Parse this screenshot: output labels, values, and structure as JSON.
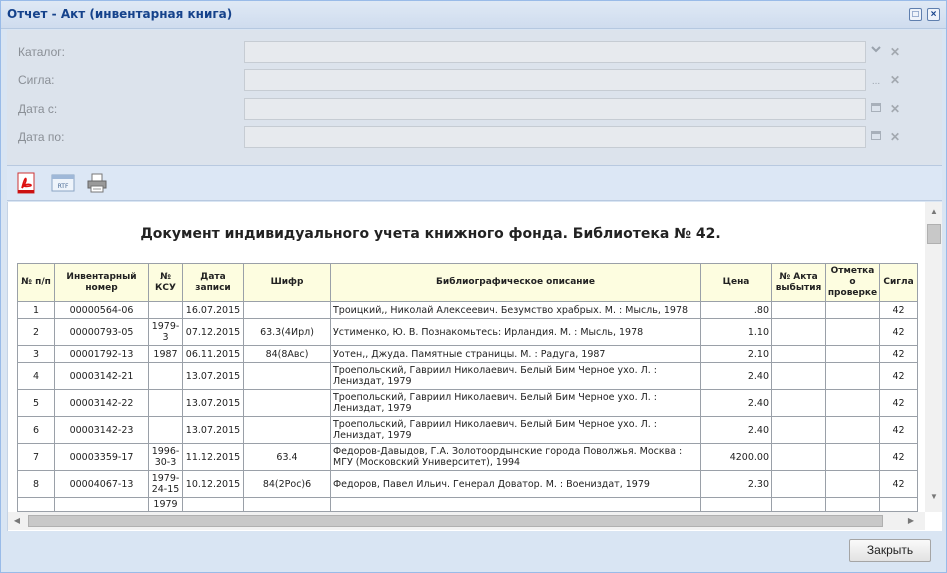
{
  "window": {
    "title": "Отчет - Акт (инвентарная книга)"
  },
  "form": {
    "fields": [
      {
        "label": "Каталог:",
        "value": "",
        "trigger": "chevron-down-icon"
      },
      {
        "label": "Сигла:",
        "value": "",
        "trigger": "ellipsis-icon"
      },
      {
        "label": "Дата с:",
        "value": "",
        "trigger": "calendar-icon"
      },
      {
        "label": "Дата по:",
        "value": "",
        "trigger": "calendar-icon"
      }
    ],
    "ellipsis": "...",
    "clear": "✕"
  },
  "toolbar": {
    "icons": [
      "pdf-icon",
      "rtf-icon",
      "print-icon"
    ],
    "rtf_text": "RTF"
  },
  "report": {
    "title": "Документ индивидуального учета книжного фонда. Библиотека № 42.",
    "columns": [
      "№ п/п",
      "Инвентарный номер",
      "№ КСУ",
      "Дата записи",
      "Шифр",
      "Библиографическое описание",
      "Цена",
      "№ Акта выбытия",
      "Отметка о проверке",
      "Сигла"
    ],
    "rows": [
      [
        "1",
        "00000564-06",
        "",
        "16.07.2015",
        "",
        "Троицкий,, Николай Алексеевич. Безумство храбрых. М. : Мысль, 1978",
        ".80",
        "",
        "",
        "42"
      ],
      [
        "2",
        "00000793-05",
        "1979-3",
        "07.12.2015",
        "63.3(4Ирл)",
        "Устименко, Ю. В. Познакомьтесь: Ирландия. М. : Мысль, 1978",
        "1.10",
        "",
        "",
        "42"
      ],
      [
        "3",
        "00001792-13",
        "1987",
        "06.11.2015",
        "84(8Авс)",
        "Уотен,, Джуда. Памятные страницы. М. : Радуга, 1987",
        "2.10",
        "",
        "",
        "42"
      ],
      [
        "4",
        "00003142-21",
        "",
        "13.07.2015",
        "",
        "Троепольский, Гавриил Николаевич. Белый Бим Черное ухо. Л. : Лениздат, 1979",
        "2.40",
        "",
        "",
        "42"
      ],
      [
        "5",
        "00003142-22",
        "",
        "13.07.2015",
        "",
        "Троепольский, Гавриил Николаевич. Белый Бим Черное ухо. Л. : Лениздат, 1979",
        "2.40",
        "",
        "",
        "42"
      ],
      [
        "6",
        "00003142-23",
        "",
        "13.07.2015",
        "",
        "Троепольский, Гавриил Николаевич. Белый Бим Черное ухо. Л. : Лениздат, 1979",
        "2.40",
        "",
        "",
        "42"
      ],
      [
        "7",
        "00003359-17",
        "1996-30-3",
        "11.12.2015",
        "63.4",
        "Федоров-Давыдов, Г.А. Золотоордынские города Поволжья. Москва : МГУ (Московский Университет), 1994",
        "4200.00",
        "",
        "",
        "42"
      ],
      [
        "8",
        "00004067-13",
        "1979-24-15",
        "10.12.2015",
        "84(2Рос)6",
        "Федоров, Павел Ильич. Генерал Доватор. М. : Воениздат, 1979",
        "2.30",
        "",
        "",
        "42"
      ],
      [
        "",
        "",
        "1979",
        "",
        "",
        "",
        "",
        "",
        "",
        ""
      ]
    ]
  },
  "buttons": {
    "close": "Закрыть"
  }
}
